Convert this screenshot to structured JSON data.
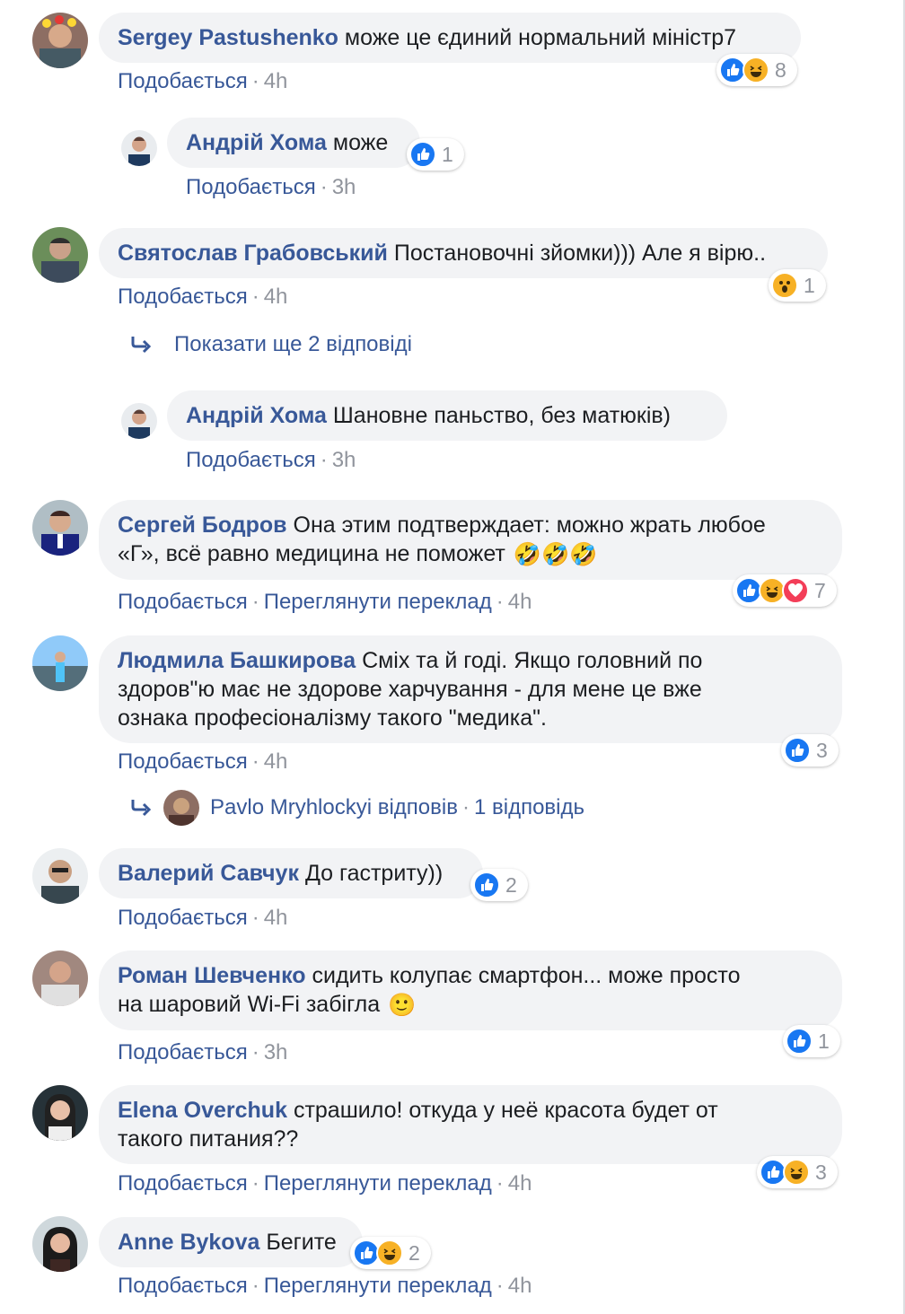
{
  "comments": [
    {
      "author": "Sergey Pastushenko",
      "text": "може це єдиний нормальний міністр7",
      "like": "Подобається",
      "time": "4h",
      "reactions": [
        "like",
        "haha"
      ],
      "reaction_count": "8"
    },
    {
      "author": "Андрій Хома",
      "text": "може",
      "like": "Подобається",
      "time": "3h",
      "reactions": [
        "like"
      ],
      "reaction_count": "1"
    },
    {
      "author": "Святослав Грабовський",
      "text": "Постановочні зйомки))) Але я вірю..",
      "like": "Подобається",
      "time": "4h",
      "reactions": [
        "wow"
      ],
      "reaction_count": "1"
    },
    {
      "author": "Андрій Хома",
      "text": "Шановне паньство, без матюків)",
      "like": "Подобається",
      "time": "3h"
    },
    {
      "author": "Сергей Бодров",
      "text": "Она этим подтверждает: можно жрать любое\n«Г», всё равно медицина не поможет",
      "like": "Подобається",
      "translate": "Переглянути переклад",
      "time": "4h",
      "reactions": [
        "like",
        "haha",
        "love"
      ],
      "reaction_count": "7",
      "emoji": "🤣🤣🤣"
    },
    {
      "author": "Людмила Башкирова",
      "text": "Сміх та й годі. Якщо головний по\nздоров\"ю має не здорове харчування - для мене це вже\nознака професіоналізму такого \"медика\".",
      "like": "Подобається",
      "time": "4h",
      "reactions": [
        "like"
      ],
      "reaction_count": "3"
    },
    {
      "author": "Валерий Савчук",
      "text": "До гастриту))",
      "like": "Подобається",
      "time": "4h",
      "reactions": [
        "like"
      ],
      "reaction_count": "2"
    },
    {
      "author": "Роман Шевченко",
      "text": "сидить колупає смартфон... може просто\nна шаровий Wi-Fi забігла",
      "like": "Подобається",
      "time": "3h",
      "reactions": [
        "like"
      ],
      "reaction_count": "1",
      "emoji": "🙂"
    },
    {
      "author": "Elena Overchuk",
      "text": "страшило! откуда у неё красота будет от\nтакого питания??",
      "like": "Подобається",
      "translate": "Переглянути переклад",
      "time": "4h",
      "reactions": [
        "like",
        "haha"
      ],
      "reaction_count": "3"
    },
    {
      "author": "Anne Bykova",
      "text": "Бегите",
      "like": "Подобається",
      "translate": "Переглянути переклад",
      "time": "4h",
      "reactions": [
        "like",
        "haha"
      ],
      "reaction_count": "2"
    }
  ],
  "more_replies": "Показати ще 2 відповіді",
  "reply_summary": {
    "name": "Pavlo Mryhlockyi відповів",
    "count": "1 відповідь"
  },
  "separator": "·",
  "colors": {
    "link": "#385898",
    "bubble": "#f2f3f5",
    "meta": "#90949c",
    "like": "#1877f2",
    "haha": "#f7b125",
    "love": "#f33e58"
  },
  "icons": [
    "like-icon",
    "haha-icon",
    "wow-icon",
    "love-icon",
    "reply-arrow-icon"
  ]
}
